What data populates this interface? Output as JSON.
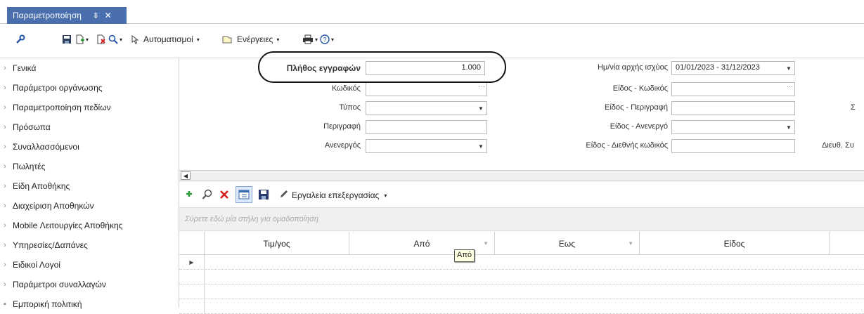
{
  "tab": {
    "title": "Παραμετροποίηση",
    "pin": "⇟",
    "close": "✕"
  },
  "toolbar": {
    "automations_label": "Αυτοματισμοί",
    "actions_label": "Ενέργειες"
  },
  "sidebar": {
    "items": [
      {
        "label": "Γενικά",
        "chevron": "›"
      },
      {
        "label": "Παράμετροι οργάνωσης",
        "chevron": "›"
      },
      {
        "label": "Παραμετροποίηση πεδίων",
        "chevron": "›"
      },
      {
        "label": "Πρόσωπα",
        "chevron": "›"
      },
      {
        "label": "Συναλλασσόμενοι",
        "chevron": "›"
      },
      {
        "label": "Πωλητές",
        "chevron": "›"
      },
      {
        "label": "Είδη Αποθήκης",
        "chevron": "›"
      },
      {
        "label": "Διαχείριση Αποθηκών",
        "chevron": "›"
      },
      {
        "label": "Mobile Λειτουργίες Αποθήκης",
        "chevron": "›"
      },
      {
        "label": "Υπηρεσίες/Δαπάνες",
        "chevron": "›"
      },
      {
        "label": "Ειδικοί Λογοί",
        "chevron": "›"
      },
      {
        "label": "Παράμετροι συναλλαγών",
        "chevron": "›"
      },
      {
        "label": "Εμπορική πολιτική",
        "chevron": "▪"
      }
    ]
  },
  "form": {
    "record_count_label": "Πλήθος εγγραφών",
    "record_count_value": "1.000",
    "code_label": "Κωδικός",
    "type_label": "Τύπος",
    "description_label": "Περιγραφή",
    "inactive_label": "Ανενεργός",
    "validity_label": "Ημ/νία αρχής ισχύος",
    "validity_value": "01/01/2023 - 31/12/2023",
    "item_code_label": "Είδος - Κωδικός",
    "item_desc_label": "Είδος - Περιγραφή",
    "item_inactive_label": "Είδος - Ανενεργό",
    "item_intl_label": "Είδος - Διεθνής κωδικός",
    "right_partial_1": "Σ",
    "right_partial_2": "Διευθ. Συ"
  },
  "grid_toolbar": {
    "tools_label": "Εργαλεία επεξεργασίας"
  },
  "grid": {
    "group_hint": "Σύρετε εδώ μία στήλη για ομαδοποίηση",
    "columns": [
      "Τιμ/γος",
      "Από",
      "Εως",
      "Είδος"
    ],
    "tooltip": "Από"
  },
  "colors": {
    "tab_bg": "#4a6fae",
    "add_green": "#2e9a3a",
    "delete_red": "#d62020"
  }
}
